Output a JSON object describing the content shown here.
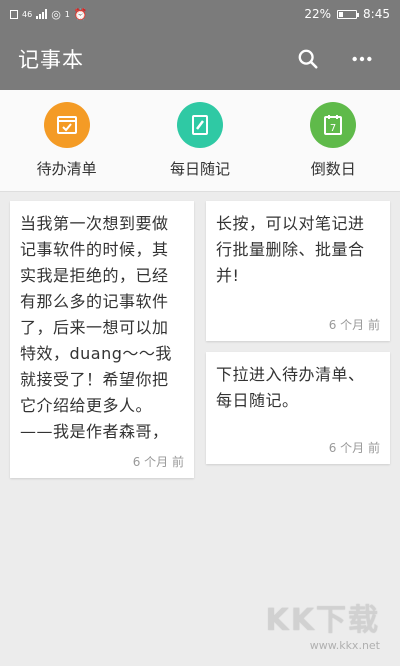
{
  "status_bar": {
    "left_labels": [
      "46",
      "1"
    ],
    "battery_percent": "22%",
    "battery_level": 0.22,
    "time": "8:45"
  },
  "app_bar": {
    "title": "记事本",
    "actions": [
      "search-icon",
      "more-icon"
    ]
  },
  "shortcuts": [
    {
      "label": "待办清单",
      "icon": "todo-icon",
      "color": "#f49b25"
    },
    {
      "label": "每日随记",
      "icon": "journal-icon",
      "color": "#2fc9a4"
    },
    {
      "label": "倒数日",
      "icon": "calendar-icon",
      "color": "#5fba4a",
      "icon_text": "7"
    }
  ],
  "notes": [
    {
      "text": "当我第一次想到要做记事软件的时候，其实我是拒绝的，已经有那么多的记事软件了，后来一想可以加特效，duang～～我就接受了！希望你把它介绍给更多人。——我是作者森哥，",
      "time": "6 个月 前"
    },
    {
      "text": "长按，可以对笔记进行批量删除、批量合并!",
      "time": "6 个月 前"
    },
    {
      "text": "下拉进入待办清单、每日随记。",
      "time": "6 个月 前"
    }
  ],
  "watermark": {
    "brand": "KK下载",
    "url": "www.kkx.net"
  }
}
